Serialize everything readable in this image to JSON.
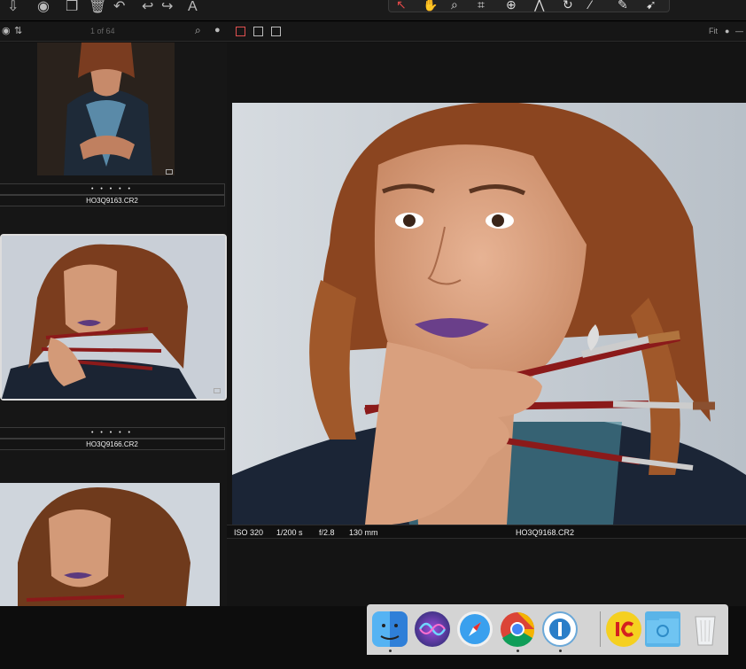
{
  "toolbar": {
    "left_icons": [
      "import-icon",
      "camera-icon",
      "copy-icon",
      "trash-icon",
      "rotate-left-icon",
      "undo-icon",
      "redo-icon",
      "text-icon"
    ],
    "right_icons": [
      "select-cursor-icon",
      "pan-icon",
      "loupe-icon",
      "crop-icon",
      "target-icon",
      "keystone-icon",
      "rotate-icon",
      "brush-icon",
      "eraser-icon",
      "picker-icon"
    ]
  },
  "browser_bar": {
    "counter": "1 of 64",
    "fit_label": "Fit"
  },
  "thumbnails": [
    {
      "stars": "• • • • •",
      "filename": "HO3Q9163.CR2"
    },
    {
      "stars": "• • • • •",
      "filename": "HO3Q9166.CR2"
    }
  ],
  "viewer": {
    "iso": "ISO 320",
    "shutter": "1/200 s",
    "aperture": "f/2.8",
    "focal": "130 mm",
    "filename": "HO3Q9168.CR2"
  },
  "dock": {
    "apps": [
      "finder-icon",
      "siri-icon",
      "safari-icon",
      "chrome-icon",
      "one-app-icon",
      "1c-icon",
      "folder-icon",
      "trash-bin-icon"
    ]
  },
  "colors": {
    "accent": "#e05050",
    "background": "#111111",
    "lip": "#6a3f8a",
    "hair": "#8b4a28"
  }
}
